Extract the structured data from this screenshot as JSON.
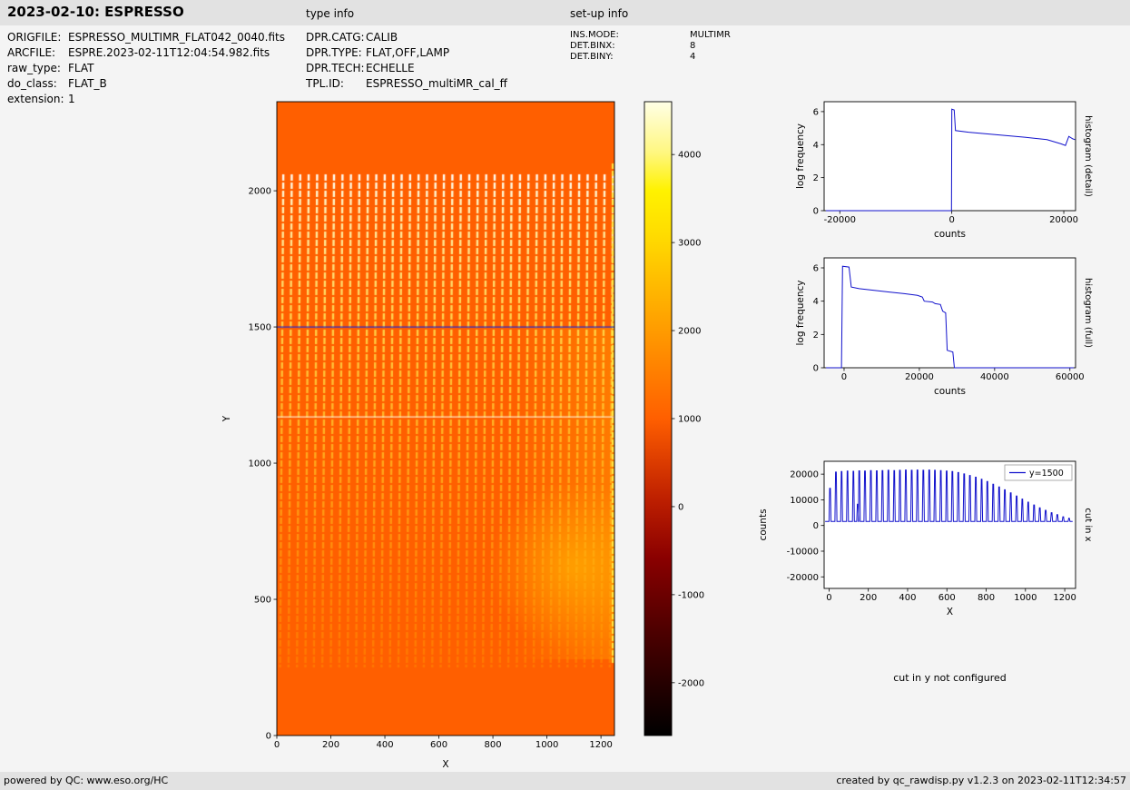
{
  "header": {
    "title": "2023-02-10: ESPRESSO",
    "type_info_heading": "type info",
    "setup_info_heading": "set-up info"
  },
  "metadata": {
    "file_info": [
      {
        "key": "ORIGFILE:",
        "value": "ESPRESSO_MULTIMR_FLAT042_0040.fits"
      },
      {
        "key": "ARCFILE:",
        "value": "ESPRE.2023-02-11T12:04:54.982.fits"
      },
      {
        "key": "raw_type:",
        "value": "FLAT"
      },
      {
        "key": "do_class:",
        "value": "FLAT_B"
      },
      {
        "key": "extension:",
        "value": "1"
      }
    ],
    "type_info": [
      {
        "key": "DPR.CATG:",
        "value": "CALIB"
      },
      {
        "key": "DPR.TYPE:",
        "value": "FLAT,OFF,LAMP"
      },
      {
        "key": "DPR.TECH:",
        "value": "ECHELLE"
      },
      {
        "key": "TPL.ID:",
        "value": "ESPRESSO_multiMR_cal_ff"
      }
    ],
    "setup_info": [
      {
        "key": "INS.MODE:",
        "value": "MULTIMR"
      },
      {
        "key": "DET.BINX:",
        "value": "8"
      },
      {
        "key": "DET.BINY:",
        "value": "4"
      }
    ]
  },
  "messages": {
    "cut_in_y": "cut in y not configured"
  },
  "footer": {
    "left": "powered by QC: www.eso.org/HC",
    "right": "created by qc_rawdisp.py v1.2.3 on 2023-02-11T12:34:57"
  },
  "chart_data": [
    {
      "id": "raw_image",
      "type": "heatmap",
      "title": "",
      "xlabel": "X",
      "ylabel": "Y",
      "xlim": [
        0,
        1250
      ],
      "ylim": [
        0,
        2327
      ],
      "xticks": [
        0,
        200,
        400,
        600,
        800,
        1000,
        1200
      ],
      "yticks": [
        0,
        500,
        1000,
        1500,
        2000
      ],
      "description": "ESPRESSO multiMR raw flat frame: ~40 slightly slanted bright echelle-order stripes, white at top (y~2060) fading to yellow-orange at bottom (y~250), on uniform orange background (~1000 counts); yellow glow on right third; bright column at right edge; pale detector gap line at y=1170; blue cut line at y=1500",
      "background_value": 1000,
      "cut_line_y": 1500,
      "gap_line_y": 1170,
      "stripes": {
        "count": 40,
        "x_start": 12,
        "x_spacing": 31.3,
        "slant": 12,
        "y_bottom": 250,
        "y_top": 2060
      },
      "colorbar": {
        "colormap": "hot",
        "vmin": -2600,
        "vmax": 4600,
        "ticks": [
          4000,
          3000,
          2000,
          1000,
          0,
          -1000,
          -2000
        ]
      }
    },
    {
      "id": "histogram_detail",
      "type": "line",
      "right_label": "histogram (detail)",
      "xlabel": "counts",
      "ylabel": "log frequency",
      "xlim": [
        -22800,
        22100
      ],
      "ylim": [
        0,
        6.6
      ],
      "xticks": [
        -20000,
        0,
        20000
      ],
      "yticks": [
        0,
        2,
        4,
        6
      ],
      "line_color": "#1111cc",
      "points": [
        [
          -22500,
          0
        ],
        [
          -60,
          0
        ],
        [
          0,
          6.15
        ],
        [
          420,
          6.1
        ],
        [
          650,
          4.85
        ],
        [
          3000,
          4.75
        ],
        [
          8000,
          4.6
        ],
        [
          13000,
          4.45
        ],
        [
          17000,
          4.3
        ],
        [
          19500,
          4.05
        ],
        [
          20300,
          3.95
        ],
        [
          20900,
          4.5
        ],
        [
          21600,
          4.35
        ],
        [
          22000,
          4.3
        ]
      ]
    },
    {
      "id": "histogram_full",
      "type": "line",
      "right_label": "histogram (full)",
      "xlabel": "counts",
      "ylabel": "log frequency",
      "xlim": [
        -5300,
        61500
      ],
      "ylim": [
        0,
        6.6
      ],
      "xticks": [
        0,
        20000,
        40000,
        60000
      ],
      "yticks": [
        0,
        2,
        4,
        6
      ],
      "line_color": "#1111cc",
      "points": [
        [
          -4800,
          0
        ],
        [
          -700,
          0
        ],
        [
          -400,
          6.1
        ],
        [
          1300,
          6.05
        ],
        [
          1900,
          4.85
        ],
        [
          4000,
          4.75
        ],
        [
          8000,
          4.65
        ],
        [
          12000,
          4.55
        ],
        [
          16000,
          4.45
        ],
        [
          19500,
          4.35
        ],
        [
          20800,
          4.25
        ],
        [
          21300,
          4.0
        ],
        [
          23500,
          3.95
        ],
        [
          24200,
          3.85
        ],
        [
          25600,
          3.8
        ],
        [
          26200,
          3.4
        ],
        [
          27000,
          3.3
        ],
        [
          27400,
          1.05
        ],
        [
          28900,
          0.95
        ],
        [
          29300,
          0
        ],
        [
          61000,
          0
        ]
      ]
    },
    {
      "id": "cut_in_x",
      "type": "line",
      "right_label": "cut in x",
      "xlabel": "X",
      "ylabel": "counts",
      "legend": {
        "label": "y=1500",
        "color": "#1111cc"
      },
      "xlim": [
        -25,
        1255
      ],
      "ylim": [
        -24500,
        25000
      ],
      "xticks": [
        0,
        200,
        400,
        600,
        800,
        1000,
        1200
      ],
      "yticks": [
        -20000,
        -10000,
        0,
        10000,
        20000
      ],
      "line_color": "#1111cc",
      "baseline": 1600,
      "peaks": [
        [
          5,
          14500
        ],
        [
          35,
          20800
        ],
        [
          64,
          21000
        ],
        [
          94,
          21200
        ],
        [
          124,
          21100
        ],
        [
          146,
          8300
        ],
        [
          154,
          21300
        ],
        [
          183,
          21200
        ],
        [
          213,
          21400
        ],
        [
          243,
          21300
        ],
        [
          272,
          21400
        ],
        [
          302,
          21500
        ],
        [
          332,
          21400
        ],
        [
          361,
          21500
        ],
        [
          391,
          21600
        ],
        [
          421,
          21500
        ],
        [
          450,
          21600
        ],
        [
          480,
          21500
        ],
        [
          510,
          21600
        ],
        [
          539,
          21500
        ],
        [
          569,
          21400
        ],
        [
          599,
          21200
        ],
        [
          628,
          21000
        ],
        [
          658,
          20600
        ],
        [
          688,
          20100
        ],
        [
          717,
          19500
        ],
        [
          747,
          18800
        ],
        [
          777,
          18000
        ],
        [
          806,
          17100
        ],
        [
          836,
          16100
        ],
        [
          866,
          15000
        ],
        [
          895,
          13900
        ],
        [
          925,
          12700
        ],
        [
          955,
          11500
        ],
        [
          984,
          10300
        ],
        [
          1014,
          9100
        ],
        [
          1044,
          8000
        ],
        [
          1073,
          6900
        ],
        [
          1103,
          5900
        ],
        [
          1133,
          5000
        ],
        [
          1162,
          4200
        ],
        [
          1192,
          3400
        ],
        [
          1222,
          2800
        ]
      ]
    }
  ]
}
